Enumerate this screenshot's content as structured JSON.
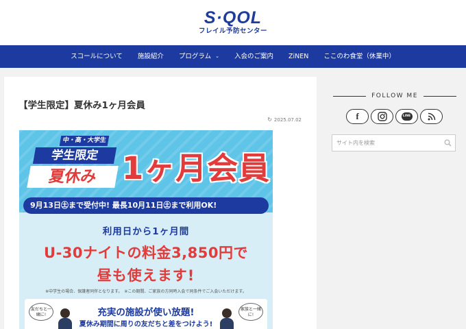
{
  "header": {
    "logo_main": "S·QOL",
    "logo_sub": "フレイル予防センター"
  },
  "nav": {
    "items": [
      {
        "label": "スコールについて"
      },
      {
        "label": "施設紹介"
      },
      {
        "label": "プログラム",
        "chevron": "⌄"
      },
      {
        "label": "入会のご案内"
      },
      {
        "label": "ZiNEN"
      },
      {
        "label": "ここのわ食堂（休業中）"
      }
    ]
  },
  "post": {
    "title": "【学生限定】夏休み1ヶ月会員",
    "date": "2025.07.02",
    "date_icon": "↻"
  },
  "banner": {
    "tag_small": "中・高・大学生",
    "tag_mid": "学生限定",
    "tag_summer": "夏休み",
    "headline": "1ヶ月会員",
    "date_bar": "9月13日㊏まで受付中! 最長10月11日㊏まで利用OK!",
    "sub_line": "利用日から1ヶ月間",
    "price_line": "U-30ナイトの料金3,850円で",
    "day_line": "昼も使えます!",
    "notes": "※中学生の場合、保護者同伴となります。　※この期間、ご家族の方同時入会で同条件でご入会いただけます。",
    "bubble_left": "友だちと一緒に!",
    "bubble_right": "家族と一緒に!",
    "bottom_head": "充実の施設が使い放題!",
    "bottom_sub": "夏休み期間に周りの友だちと差をつけよう!"
  },
  "sidebar": {
    "follow_title": "FOLLOW ME",
    "social": [
      {
        "name": "facebook-icon",
        "glyph": "f"
      },
      {
        "name": "instagram-icon"
      },
      {
        "name": "line-icon",
        "glyph": "LINE"
      },
      {
        "name": "rss-icon"
      }
    ],
    "search_placeholder": "サイト内を検索"
  },
  "colors": {
    "nav_bg": "#1d3aa0",
    "logo_blue": "#1e3c9b",
    "accent_red": "#e23b3b",
    "banner_sky": "#5ec4e8"
  }
}
